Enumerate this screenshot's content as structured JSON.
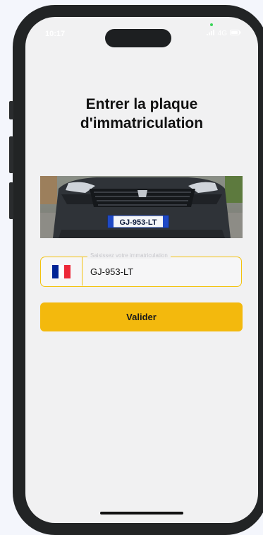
{
  "status_bar": {
    "time": "10:17",
    "signal": "4G",
    "battery_icon": "battery-icon"
  },
  "page": {
    "title_line1": "Entrer la plaque",
    "title_line2": "d'immatriculation"
  },
  "car_photo": {
    "plate_text": "GJ-953-LT"
  },
  "plate_input": {
    "label": "Saisissez votre immatriculation",
    "value": "GJ-953-LT",
    "country_flag": "france-flag-icon"
  },
  "actions": {
    "submit_label": "Valider"
  },
  "colors": {
    "accent": "#f3b90d",
    "field_border": "#f3c20c",
    "flag_blue": "#002395",
    "flag_white": "#ffffff",
    "flag_red": "#ed2939"
  }
}
